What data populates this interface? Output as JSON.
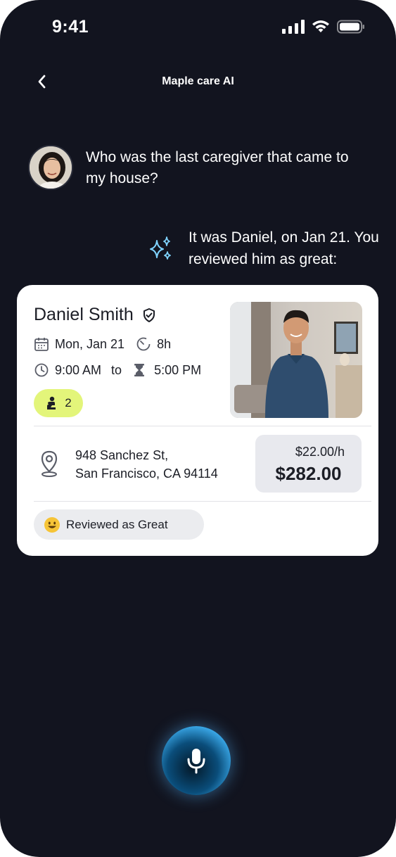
{
  "status_bar": {
    "time": "9:41"
  },
  "nav": {
    "title": "Maple care AI"
  },
  "conversation": {
    "user_message": "Who was the last caregiver that came to my house?",
    "ai_message": "It was Daniel, on Jan 21. You reviewed him as great:"
  },
  "card": {
    "name": "Daniel Smith",
    "date": "Mon, Jan 21",
    "duration": "8h",
    "start_time": "9:00 AM",
    "to_label": "to",
    "end_time": "5:00 PM",
    "count": "2",
    "address_line1": "948 Sanchez St,",
    "address_line2": "San Francisco, CA 94114",
    "rate": "$22.00/h",
    "total": "$282.00",
    "review": "Reviewed as Great"
  },
  "colors": {
    "background": "#12141f",
    "card": "#ffffff",
    "chip_accent": "#e3f57a",
    "ai_accent": "#7fd3ff"
  },
  "icons": [
    "signal-icon",
    "wifi-icon",
    "battery-icon",
    "chevron-left-icon",
    "sparkle-icon",
    "verified-shield-icon",
    "calendar-icon",
    "timer-icon",
    "clock-icon",
    "hourglass-icon",
    "person-icon",
    "location-pin-icon",
    "smiley-emoji-icon",
    "microphone-icon"
  ]
}
